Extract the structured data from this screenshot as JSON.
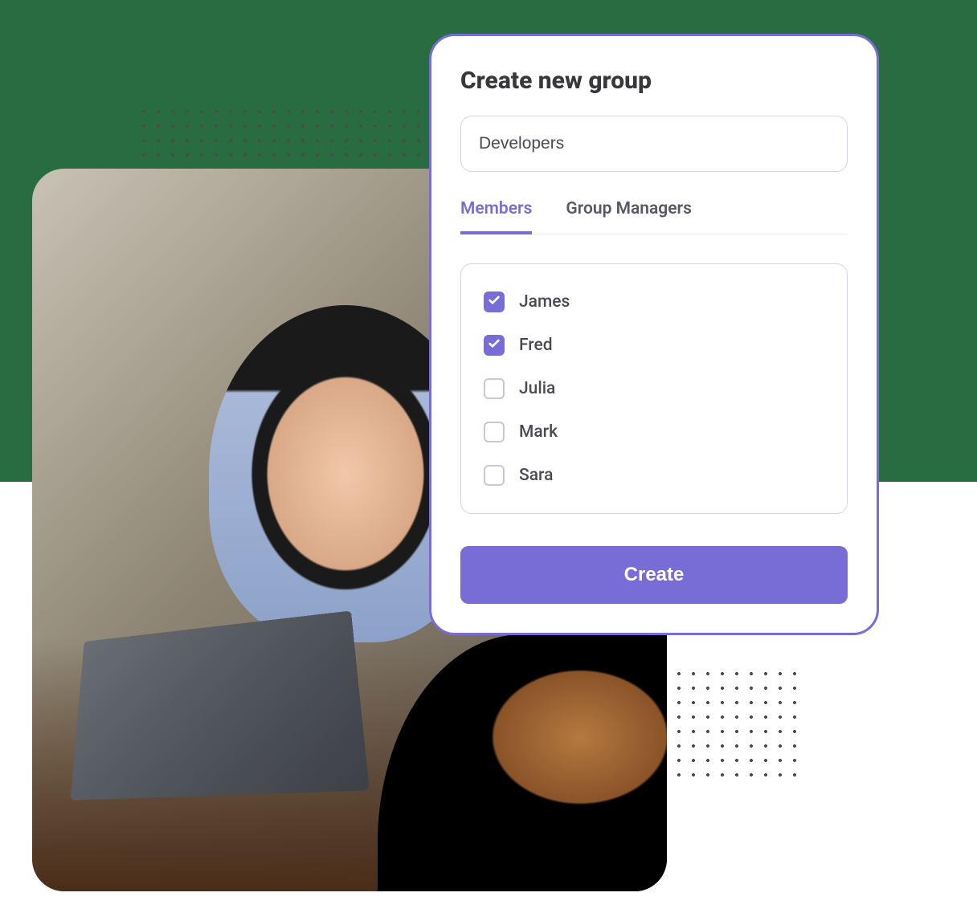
{
  "modal": {
    "title": "Create new group",
    "group_name_value": "Developers",
    "tabs": [
      {
        "label": "Members",
        "active": true
      },
      {
        "label": "Group Managers",
        "active": false
      }
    ],
    "members": [
      {
        "name": "James",
        "checked": true
      },
      {
        "name": "Fred",
        "checked": true
      },
      {
        "name": "Julia",
        "checked": false
      },
      {
        "name": "Mark",
        "checked": false
      },
      {
        "name": "Sara",
        "checked": false
      }
    ],
    "create_label": "Create"
  },
  "colors": {
    "accent": "#786dd6",
    "heading": "#38383b",
    "text": "#4b4953",
    "bg_green": "#2a6c41"
  }
}
